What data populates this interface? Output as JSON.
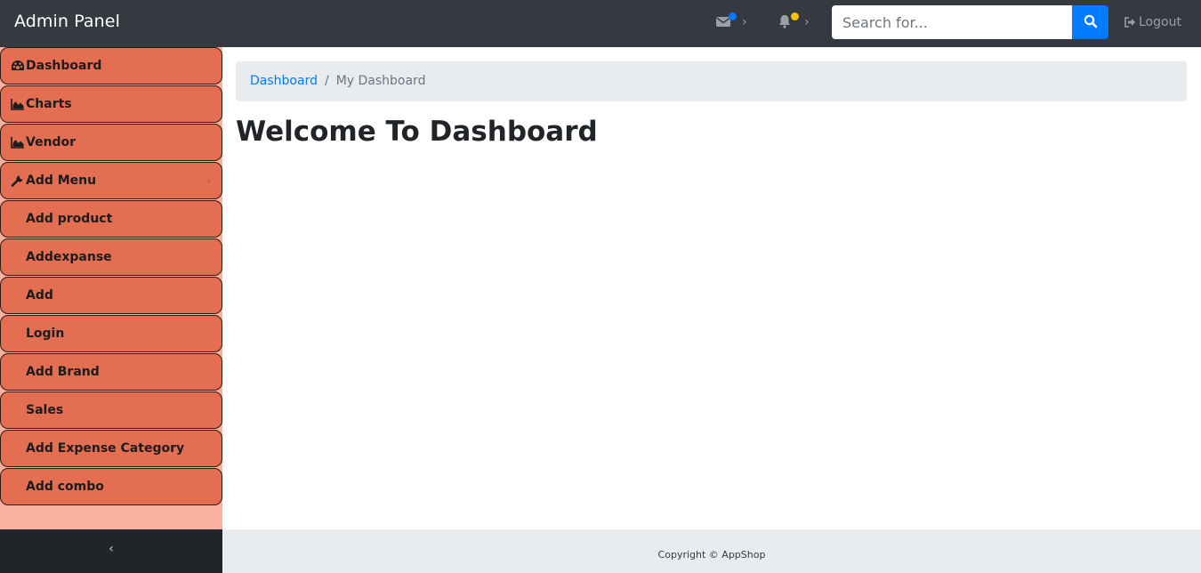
{
  "topbar": {
    "brand": "Admin Panel",
    "messages_icon": "envelope-icon",
    "notifications_icon": "bell-icon",
    "search": {
      "placeholder": "Search for...",
      "value": "",
      "button_icon": "search-icon"
    },
    "logout_label": "Logout",
    "logout_icon": "sign-out-icon",
    "colors": {
      "bar": "#343a40",
      "message_dot": "#007bff",
      "notification_dot": "#ffc107",
      "search_button": "#007bff"
    }
  },
  "sidebar": {
    "colors": {
      "item_bg": "#e46e52",
      "panel_bg": "#fab19f",
      "footer_bg": "#212529"
    },
    "items": [
      {
        "label": "Dashboard",
        "icon": "tachometer-icon"
      },
      {
        "label": "Charts",
        "icon": "area-chart-icon"
      },
      {
        "label": "Vendor",
        "icon": "area-chart-icon"
      },
      {
        "label": "Add Menu",
        "icon": "wrench-icon",
        "has_submenu": true
      },
      {
        "label": "Add product"
      },
      {
        "label": "Addexpanse"
      },
      {
        "label": "Add"
      },
      {
        "label": "Login"
      },
      {
        "label": "Add Brand"
      },
      {
        "label": "Sales"
      },
      {
        "label": "Add Expense Category"
      },
      {
        "label": "Add combo"
      }
    ],
    "collapse_label": "‹",
    "collapse_icon": "chevron-left-icon"
  },
  "breadcrumb": {
    "link": "Dashboard",
    "separator": "/",
    "current": "My Dashboard"
  },
  "page": {
    "title": "Welcome To Dashboard"
  },
  "footer": {
    "copyright": "Copyright © AppShop"
  }
}
